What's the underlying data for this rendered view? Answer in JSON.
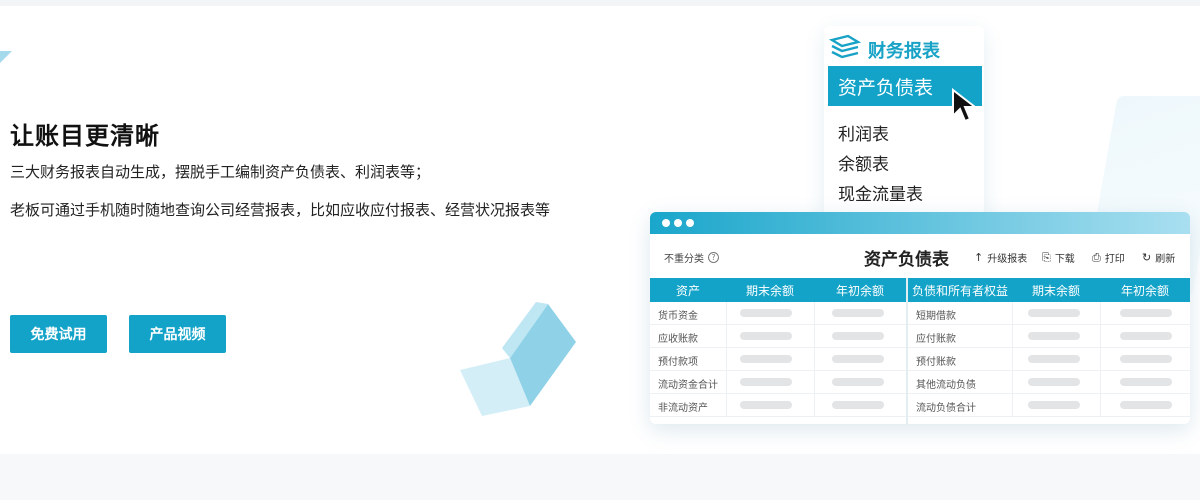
{
  "hero": {
    "headline": "让账目更清晰",
    "desc1": "三大财务报表自动生成，摆脱手工编制资产负债表、利润表等；",
    "desc2": "老板可通过手机随时随地查询公司经营报表，比如应收应付报表、经营状况报表等",
    "buttons": {
      "trial": "免费试用",
      "video": "产品视频"
    }
  },
  "menu": {
    "title": "财务报表",
    "active": "资产负债表",
    "items": [
      "利润表",
      "余额表",
      "现金流量表"
    ]
  },
  "report": {
    "unclassified": "不重分类",
    "title": "资产负债表",
    "tools": {
      "upgrade": "升级报表",
      "download": "下载",
      "print": "打印",
      "refresh": "刷新"
    },
    "headers": [
      "资产",
      "期末余额",
      "年初余额",
      "负债和所有者权益",
      "期末余额",
      "年初余额"
    ],
    "rows": [
      {
        "left": "货币资金",
        "right": "短期借款"
      },
      {
        "left": "应收账款",
        "right": "应付账款"
      },
      {
        "left": "预付款项",
        "right": "预付账款"
      },
      {
        "left": "流动资金合计",
        "right": "其他流动负债"
      },
      {
        "left": "非流动资产",
        "right": "流动负债合计"
      }
    ]
  },
  "colors": {
    "accent": "#13a3c8",
    "accent_light": "#a9dff0",
    "placeholder": "#e2e4e6"
  },
  "icons": [
    "help-icon",
    "upgrade-arrow-icon",
    "download-icon",
    "print-icon",
    "refresh-icon",
    "report-logo-icon",
    "cursor-arrow-icon"
  ]
}
